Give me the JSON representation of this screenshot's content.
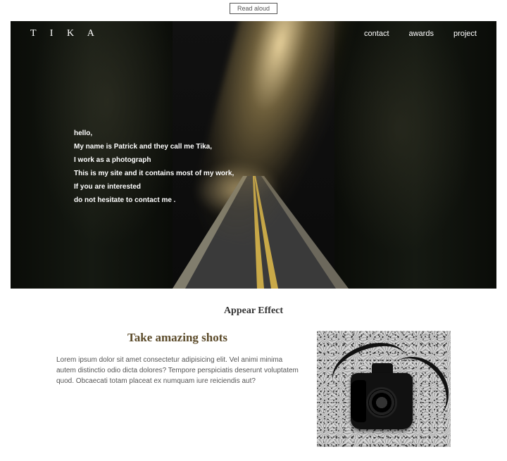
{
  "topbar": {
    "button_label": "Read aloud"
  },
  "brand": {
    "logo": "T I K A"
  },
  "nav": {
    "contact": "contact",
    "awards": "awards",
    "project": "project"
  },
  "intro": {
    "line1": "hello,",
    "line2": "My name is Patrick and they call me Tika,",
    "line3": "I work as a photograph",
    "line4": "This is my site and it contains most of my work,",
    "line5": "If you are interested",
    "line6": "do not hesitate to contact me ."
  },
  "section": {
    "title": "Appear Effect"
  },
  "feature": {
    "heading": "Take amazing shots",
    "body": "Lorem ipsum dolor sit amet consectetur adipisicing elit. Vel animi minima autem distinctio odio dicta dolores? Tempore perspiciatis deserunt voluptatem quod. Obcaecati totam placeat ex numquam iure reiciendis aut?"
  }
}
